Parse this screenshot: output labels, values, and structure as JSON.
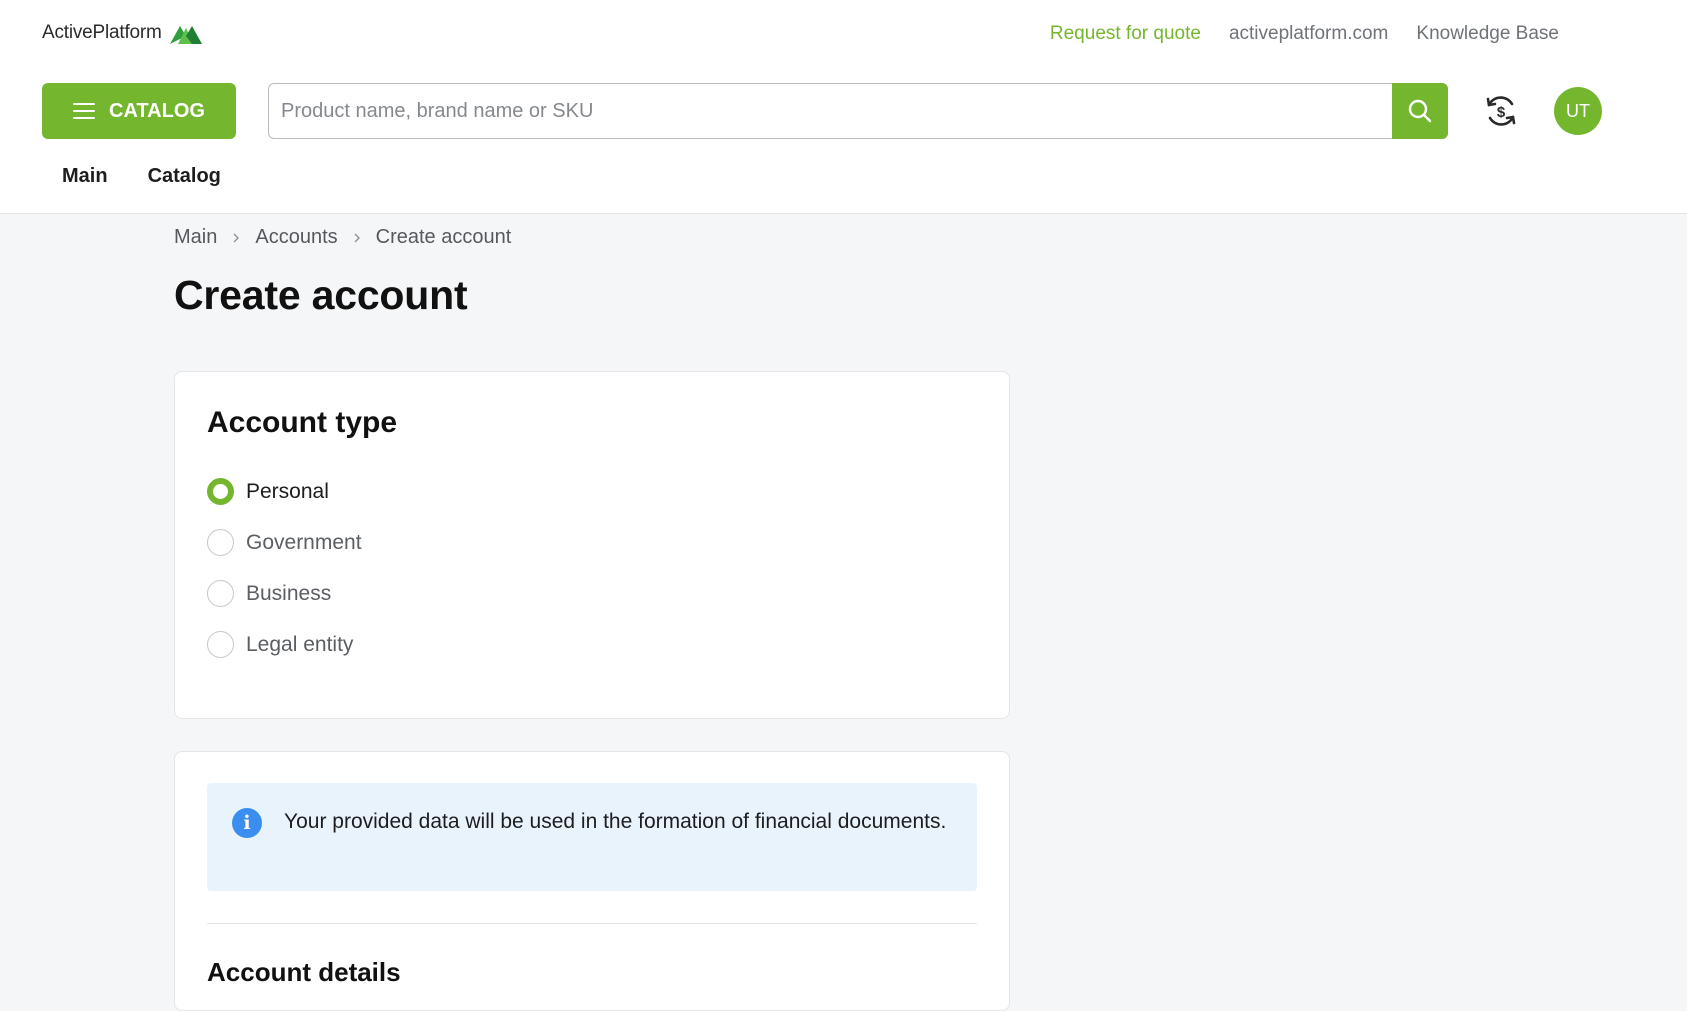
{
  "brand": {
    "name": "ActivePlatform",
    "accent": "#74b72e",
    "logo_icon": "activeplatform-logo-icon"
  },
  "top_links": [
    {
      "label": "Request for quote"
    },
    {
      "label": "activeplatform.com"
    },
    {
      "label": "Knowledge Base"
    }
  ],
  "header": {
    "catalog_label": "CATALOG",
    "search": {
      "placeholder": "Product name, brand name or SKU",
      "value": ""
    },
    "avatar_initials": "UT"
  },
  "nav": [
    {
      "label": "Main"
    },
    {
      "label": "Catalog"
    }
  ],
  "breadcrumb": [
    {
      "label": "Main"
    },
    {
      "label": "Accounts"
    },
    {
      "label": "Create account"
    }
  ],
  "page_title": "Create account",
  "account_type": {
    "title": "Account type",
    "selected": "Personal",
    "options": [
      {
        "label": "Personal"
      },
      {
        "label": "Government"
      },
      {
        "label": "Business"
      },
      {
        "label": "Legal entity"
      }
    ]
  },
  "notice": {
    "text": "Your provided data will be used in the formation of financial documents."
  },
  "account_details": {
    "title": "Account details"
  },
  "colors": {
    "accent": "#74b72e",
    "info_bg": "#e9f3fc",
    "info_icon": "#3a8ef0",
    "page_bg": "#f5f6f8"
  }
}
